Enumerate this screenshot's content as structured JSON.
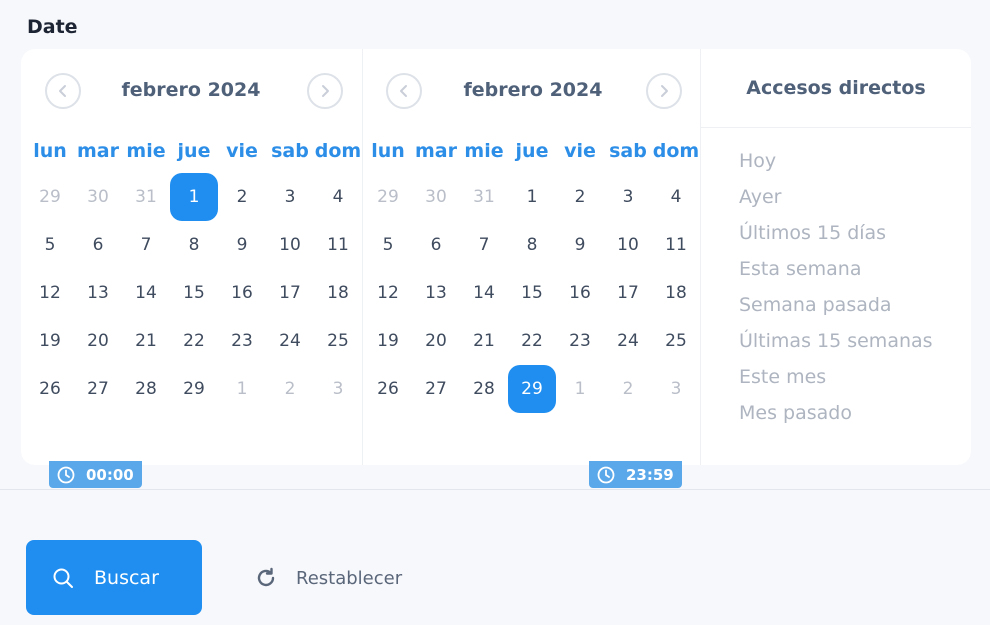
{
  "field_label": "Date",
  "left_calendar": {
    "title": "febrero 2024",
    "weekdays": [
      "lun",
      "mar",
      "mie",
      "jue",
      "vie",
      "sab",
      "dom"
    ],
    "days": [
      {
        "n": "29",
        "m": true
      },
      {
        "n": "30",
        "m": true
      },
      {
        "n": "31",
        "m": true
      },
      {
        "n": "1",
        "s": true
      },
      {
        "n": "2"
      },
      {
        "n": "3"
      },
      {
        "n": "4"
      },
      {
        "n": "5"
      },
      {
        "n": "6"
      },
      {
        "n": "7"
      },
      {
        "n": "8"
      },
      {
        "n": "9"
      },
      {
        "n": "10"
      },
      {
        "n": "11"
      },
      {
        "n": "12"
      },
      {
        "n": "13"
      },
      {
        "n": "14"
      },
      {
        "n": "15"
      },
      {
        "n": "16"
      },
      {
        "n": "17"
      },
      {
        "n": "18"
      },
      {
        "n": "19"
      },
      {
        "n": "20"
      },
      {
        "n": "21"
      },
      {
        "n": "22"
      },
      {
        "n": "23"
      },
      {
        "n": "24"
      },
      {
        "n": "25"
      },
      {
        "n": "26"
      },
      {
        "n": "27"
      },
      {
        "n": "28"
      },
      {
        "n": "29"
      },
      {
        "n": "1",
        "m": true
      },
      {
        "n": "2",
        "m": true
      },
      {
        "n": "3",
        "m": true
      }
    ]
  },
  "right_calendar": {
    "title": "febrero 2024",
    "weekdays": [
      "lun",
      "mar",
      "mie",
      "jue",
      "vie",
      "sab",
      "dom"
    ],
    "days": [
      {
        "n": "29",
        "m": true
      },
      {
        "n": "30",
        "m": true
      },
      {
        "n": "31",
        "m": true
      },
      {
        "n": "1"
      },
      {
        "n": "2"
      },
      {
        "n": "3"
      },
      {
        "n": "4"
      },
      {
        "n": "5"
      },
      {
        "n": "6"
      },
      {
        "n": "7"
      },
      {
        "n": "8"
      },
      {
        "n": "9"
      },
      {
        "n": "10"
      },
      {
        "n": "11"
      },
      {
        "n": "12"
      },
      {
        "n": "13"
      },
      {
        "n": "14"
      },
      {
        "n": "15"
      },
      {
        "n": "16"
      },
      {
        "n": "17"
      },
      {
        "n": "18"
      },
      {
        "n": "19"
      },
      {
        "n": "20"
      },
      {
        "n": "21"
      },
      {
        "n": "22"
      },
      {
        "n": "23"
      },
      {
        "n": "24"
      },
      {
        "n": "25"
      },
      {
        "n": "26"
      },
      {
        "n": "27"
      },
      {
        "n": "28"
      },
      {
        "n": "29",
        "s": true
      },
      {
        "n": "1",
        "m": true
      },
      {
        "n": "2",
        "m": true
      },
      {
        "n": "3",
        "m": true
      }
    ]
  },
  "shortcuts": {
    "title": "Accesos directos",
    "items": [
      "Hoy",
      "Ayer",
      "Últimos 15 días",
      "Esta semana",
      "Semana pasada",
      "Últimas 15 semanas",
      "Este mes",
      "Mes pasado"
    ]
  },
  "start_time": "00:00",
  "end_time": "23:59",
  "search_label": "Buscar",
  "reset_label": "Restablecer",
  "icons": {
    "prev": "chevron-left-circle-icon",
    "next": "chevron-right-circle-icon",
    "clock": "clock-icon",
    "search": "search-icon",
    "reset": "refresh-icon"
  },
  "colors": {
    "accent": "#1f8ef0",
    "time_tag": "#5aa8ea",
    "weekday": "#2d8ee8"
  }
}
